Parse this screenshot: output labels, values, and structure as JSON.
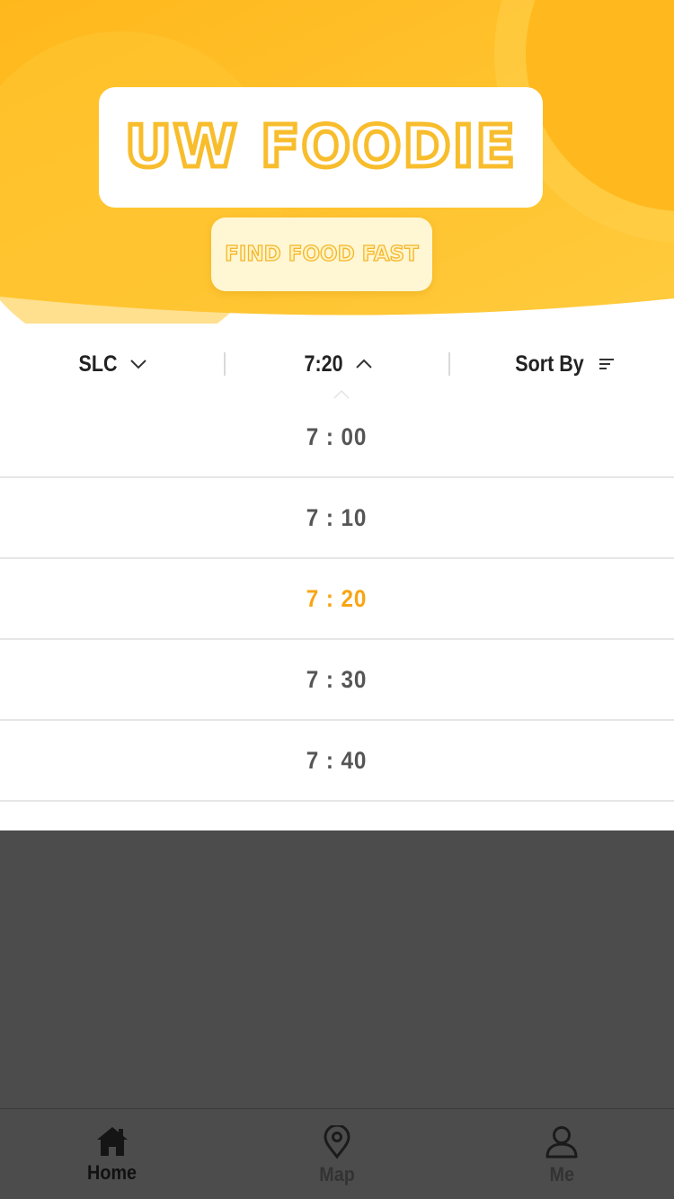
{
  "header": {
    "title": "UW FOODIE",
    "tagline": "FIND FOOD FAST"
  },
  "filters": {
    "location": {
      "label": "SLC",
      "icon": "chevron-down-icon"
    },
    "time": {
      "label": "7:20",
      "icon": "chevron-up-icon"
    },
    "sort": {
      "label": "Sort By",
      "icon": "sort-lines-icon"
    }
  },
  "time_options": {
    "items": [
      "7 : 00",
      "7 : 10",
      "7 : 20",
      "7 : 30",
      "7 : 40"
    ],
    "selected": "7 : 20"
  },
  "tabbar": {
    "home": {
      "label": "Home",
      "icon": "home-icon"
    },
    "map": {
      "label": "Map",
      "icon": "map-pin-icon"
    },
    "me": {
      "label": "Me",
      "icon": "user-icon"
    }
  },
  "colors": {
    "accent": "#f8a513",
    "banner": "#ffc12e",
    "mask": "#4c4c4c"
  }
}
